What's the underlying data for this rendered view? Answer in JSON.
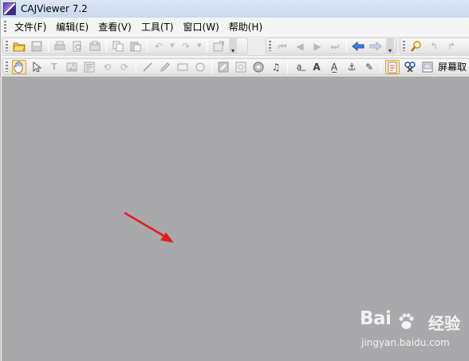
{
  "window": {
    "title": "CAJViewer 7.2"
  },
  "menubar": {
    "items": [
      "文件(F)",
      "编辑(E)",
      "查看(V)",
      "工具(T)",
      "窗口(W)",
      "帮助(H)"
    ]
  },
  "toolbar2": {
    "screenshot_label": "屏幕取"
  },
  "watermark": {
    "brand": "Bai",
    "brand_cn": "经验",
    "url": "jingyan.baidu.com"
  },
  "colors": {
    "document_bg": "#a9a8ab",
    "annotation_arrow": "#e02020",
    "titlebar": "#d4e0f2"
  }
}
